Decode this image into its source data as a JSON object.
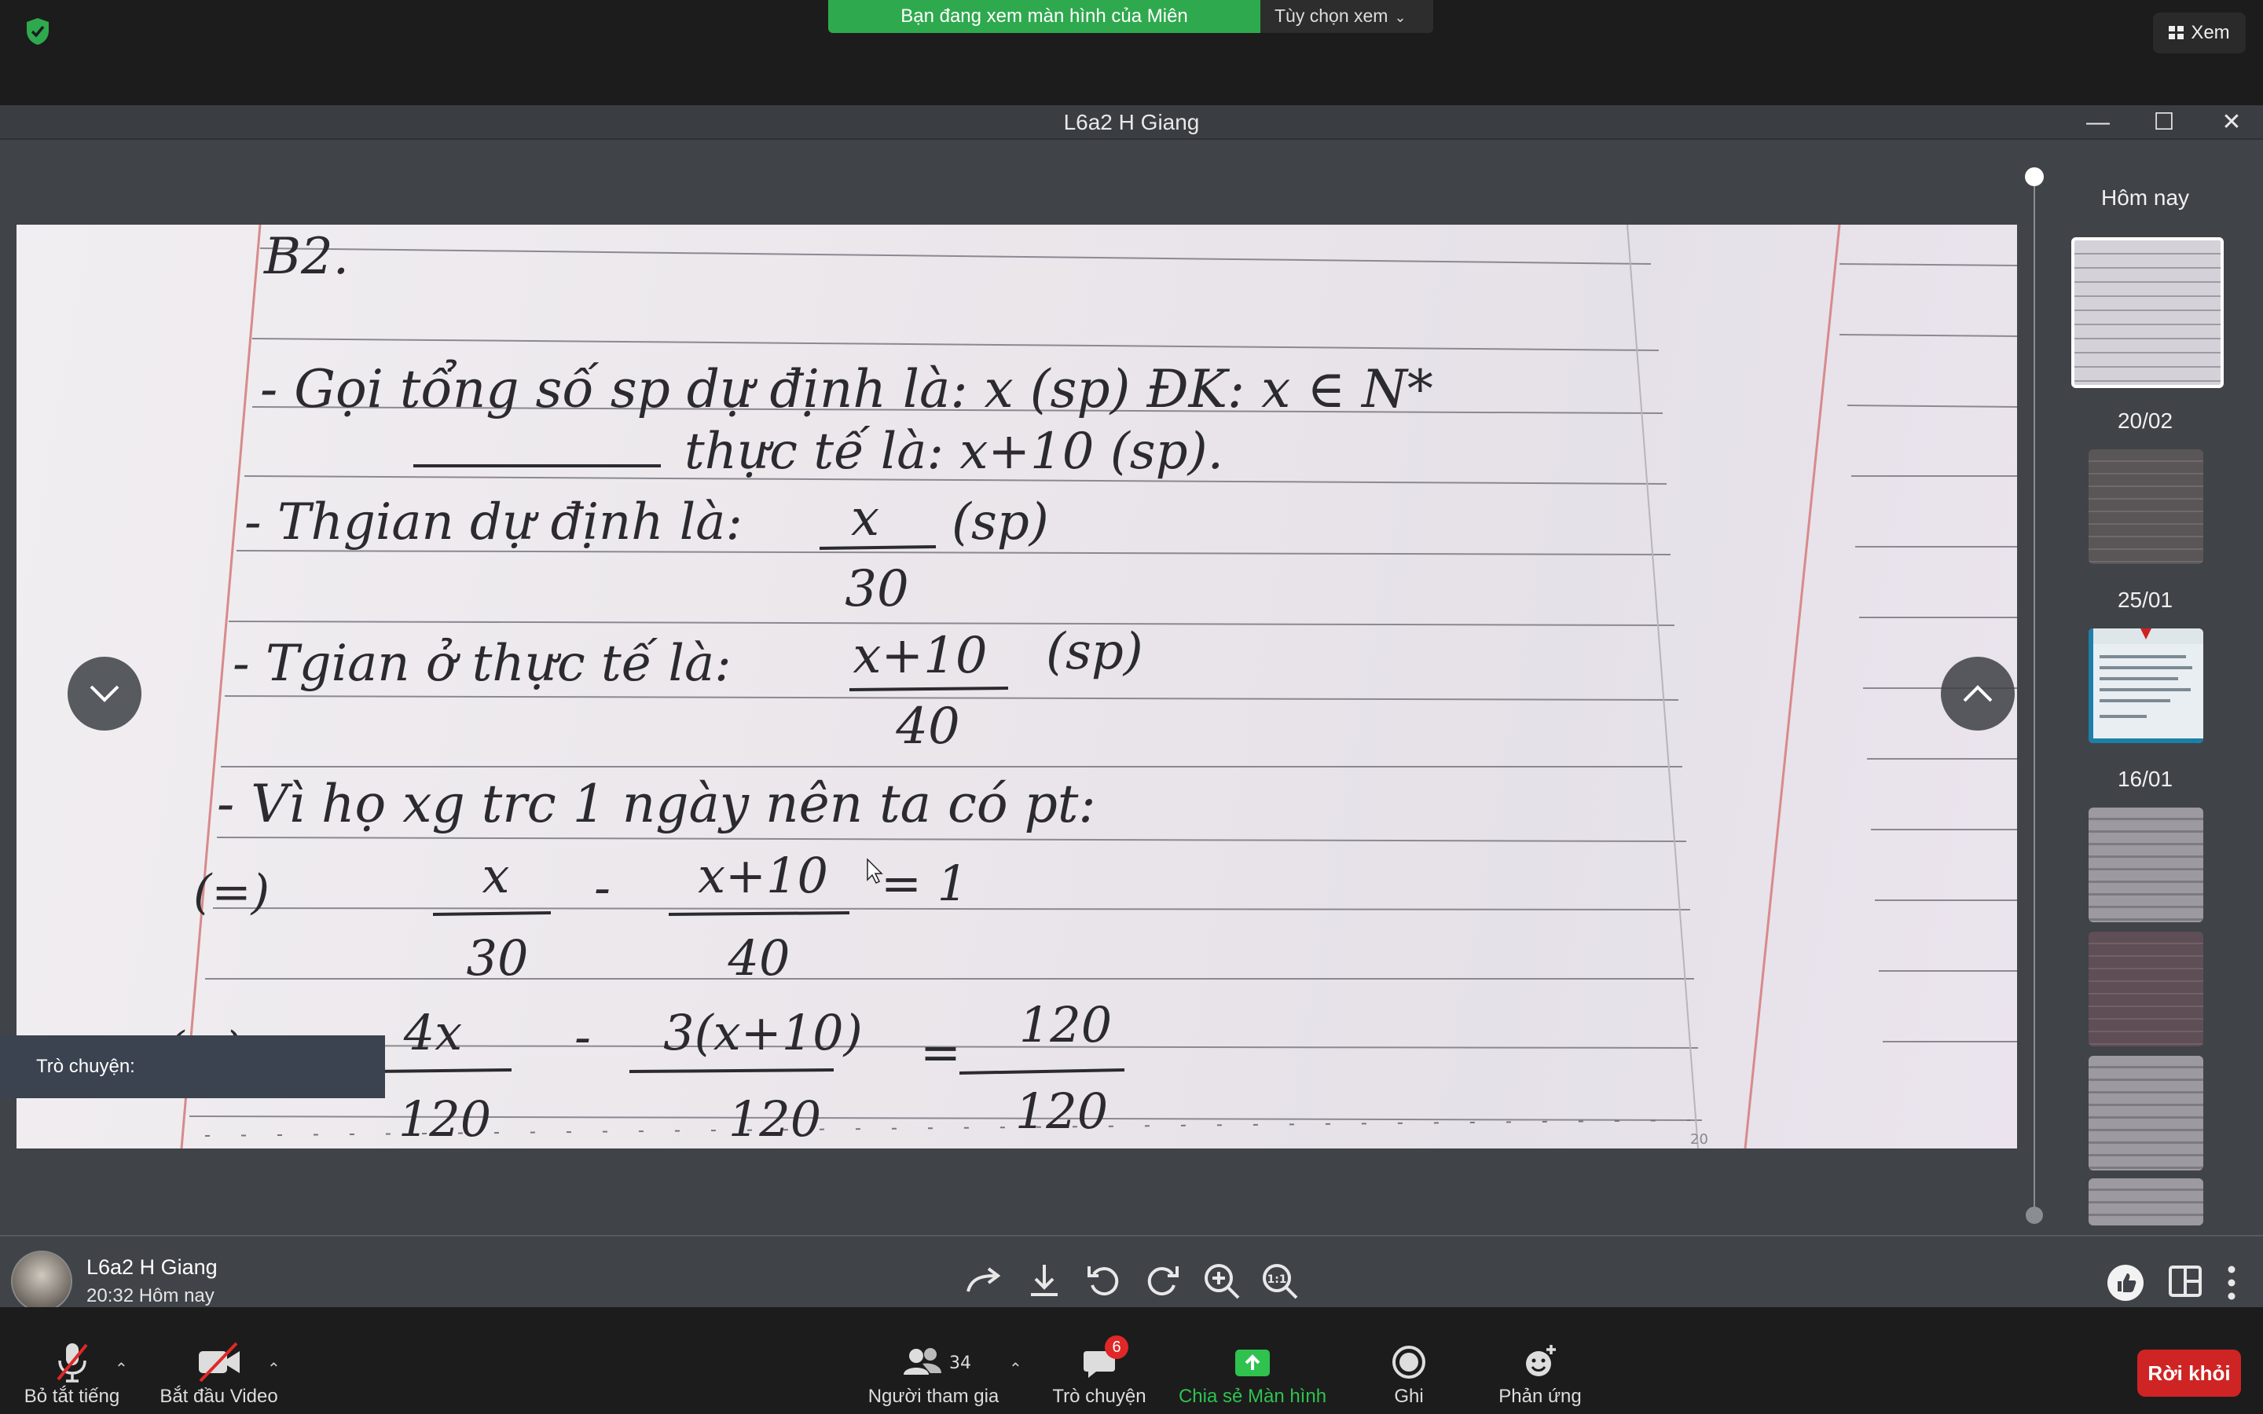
{
  "top": {
    "banner": "Bạn đang xem màn hình của Miên",
    "view_options": "Tùy chọn xem",
    "view_button": "Xem"
  },
  "window": {
    "title": "L6a2 H Giang",
    "minimize_glyph": "—",
    "maximize_glyph": "☐",
    "close_glyph": "✕"
  },
  "photo": {
    "lines": [
      "B2.",
      "- Gọi tổng số sp dự định là: x (sp) ĐK: x ∈ N*",
      "thực tế là: x+10 (sp).",
      "- Thgian dự định là:",
      "- Tgian ở thực tế là:",
      "- Vì họ xg trc 1 ngày nên ta có pt:"
    ],
    "fraction_1": {
      "num": "x",
      "den": "30",
      "unit": "(sp)"
    },
    "fraction_2": {
      "num": "x+10",
      "den": "40",
      "unit": "(sp)"
    },
    "equation_1": {
      "lhs": "(=)",
      "a_num": "x",
      "a_den": "30",
      "b_num": "x+10",
      "b_den": "40",
      "rhs": "= 1"
    },
    "equation_2": {
      "lhs": "(=)",
      "a_num": "4x",
      "a_den": "120",
      "b_num": "3(x+10)",
      "b_den": "120",
      "c_num": "120",
      "c_den": "120"
    },
    "page_number": "20"
  },
  "chat_box": {
    "label": "Trò chuyện:"
  },
  "timeline": {
    "groups": [
      "Hôm nay",
      "20/02",
      "25/01",
      "16/01"
    ]
  },
  "info": {
    "name": "L6a2 H Giang",
    "time": "20:32 Hôm nay"
  },
  "controls": {
    "mute": "Bỏ tắt tiếng",
    "video": "Bắt đầu Video",
    "participants": "Người tham gia",
    "participants_count": "34",
    "chat": "Trò chuyện",
    "chat_badge": "6",
    "share": "Chia sẻ Màn hình",
    "record": "Ghi",
    "reactions": "Phản ứng",
    "leave": "Rời khỏi"
  }
}
